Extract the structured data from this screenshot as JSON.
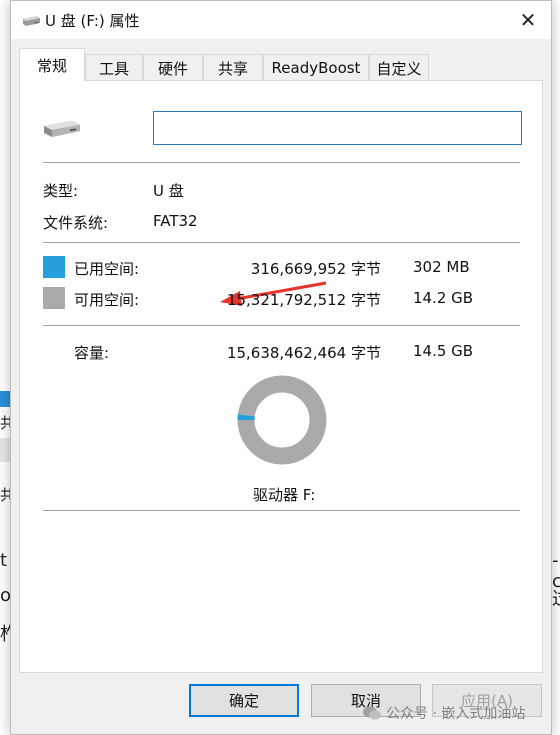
{
  "window": {
    "title": "U 盘 (F:) 属性",
    "close_glyph": "✕"
  },
  "tabs": [
    {
      "label": "常规",
      "active": true
    },
    {
      "label": "工具",
      "active": false
    },
    {
      "label": "硬件",
      "active": false
    },
    {
      "label": "共享",
      "active": false
    },
    {
      "label": "ReadyBoost",
      "active": false
    },
    {
      "label": "自定义",
      "active": false
    }
  ],
  "general": {
    "volume_label_value": "",
    "type_label": "类型:",
    "type_value": "U 盘",
    "fs_label": "文件系统:",
    "fs_value": "FAT32",
    "used": {
      "label": "已用空间:",
      "bytes": "316,669,952 字节",
      "size": "302 MB",
      "color": "#26a0da"
    },
    "free": {
      "label": "可用空间:",
      "bytes": "15,321,792,512 字节",
      "size": "14.2 GB",
      "color": "#aaaaaa"
    },
    "capacity": {
      "label": "容量:",
      "bytes": "15,638,462,464 字节",
      "size": "14.5 GB"
    },
    "drive_caption": "驱动器 F:",
    "used_fraction": 0.0203
  },
  "annotation_color": "#e8332a",
  "buttons": {
    "ok": "确定",
    "cancel": "取消",
    "apply": "应用(A)"
  },
  "background_fragments": {
    "frag1": "t",
    "frag2": "o",
    "frag3": "柞",
    "frag4": "共",
    "frag5": "共",
    "frag6": "-c",
    "frag7": "过"
  },
  "watermark": "公众号 · 嵌入式加油站"
}
